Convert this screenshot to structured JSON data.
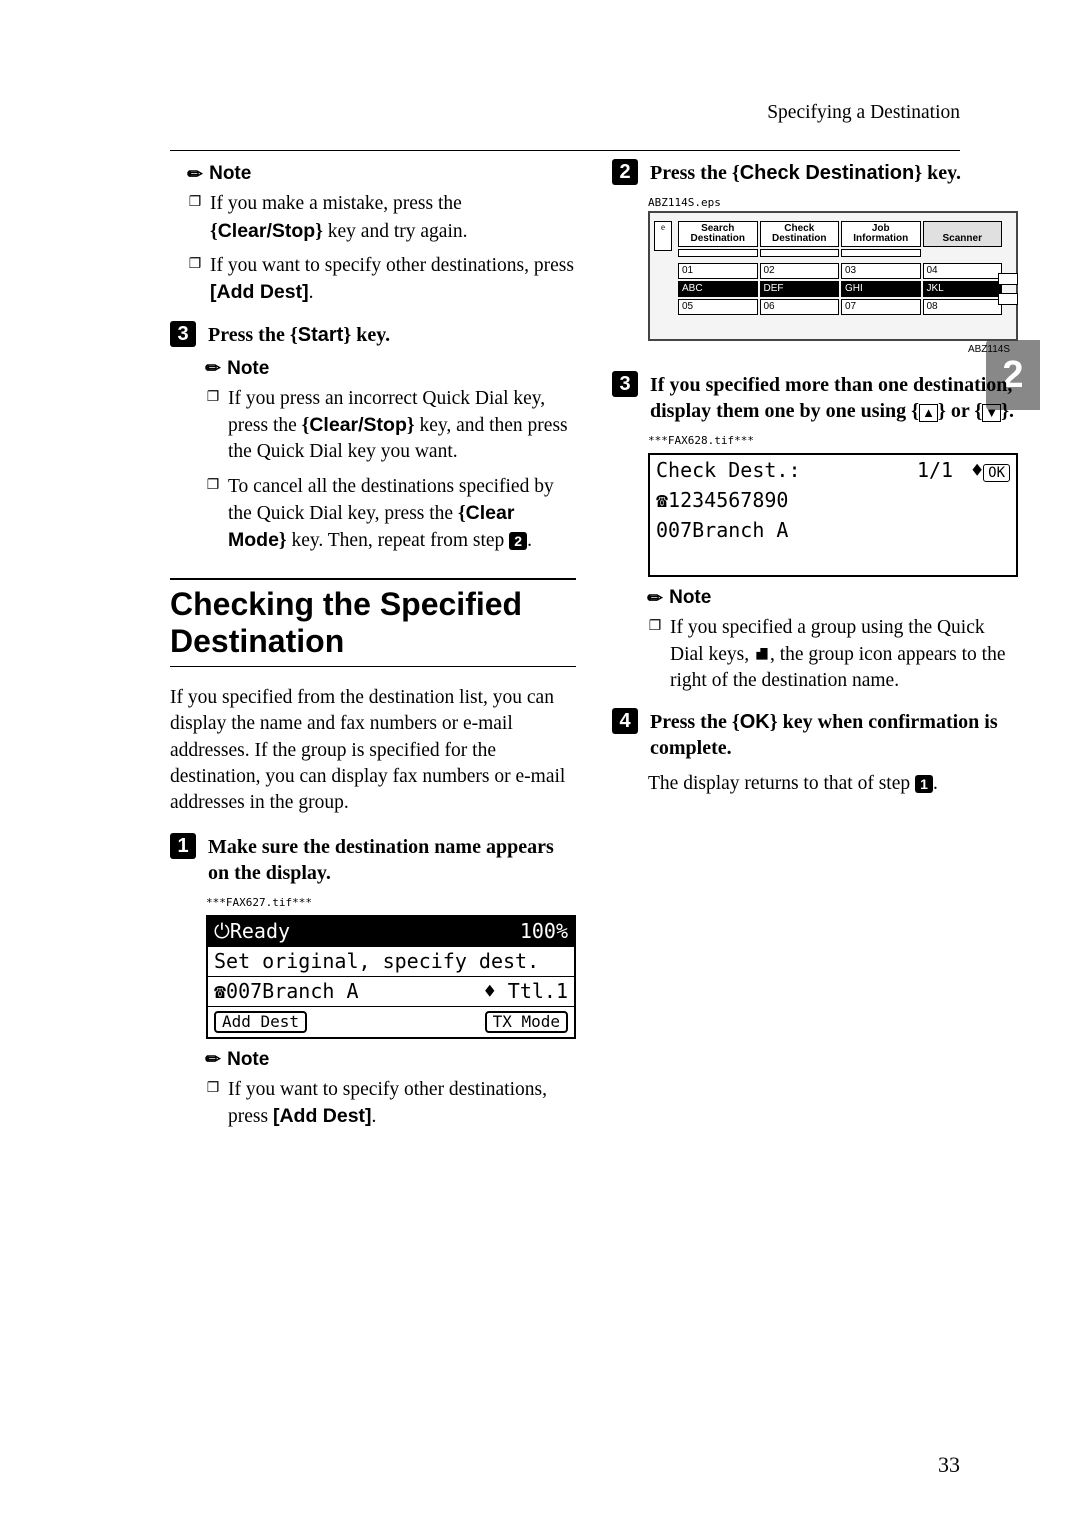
{
  "header": {
    "section": "Specifying a Destination"
  },
  "sideTab": "2",
  "pageNum": "33",
  "left": {
    "noteLabel": "Note",
    "note1a": "If you make a mistake, press the ",
    "note1b_key": "Clear/Stop",
    "note1c": " key and try again.",
    "note2a": "If you want to specify other destinations, press ",
    "note2b_key": "[Add Dest]",
    "note2c": ".",
    "step3_num": "3",
    "step3a": "Press the ",
    "step3_key": "Start",
    "step3b": " key.",
    "sub_noteLabel": "Note",
    "sub1a": "If you press an incorrect Quick Dial key, press the ",
    "sub1_key": "Clear/Stop",
    "sub1b": " key, and then press the Quick Dial key you want.",
    "sub2a": "To cancel all the destinations specified by the Quick Dial key, press the ",
    "sub2_key": "Clear Mode",
    "sub2b": " key. Then, repeat from step ",
    "sub2_step": "2",
    "sub2c": ".",
    "sectionTitle": "Checking the Specified Destination",
    "para": "If you specified from the destination list, you can display the name and fax numbers or e-mail addresses. If the group is specified for the destination, you can display fax numbers or e-mail addresses in the group.",
    "step1_num": "1",
    "step1": "Make sure the destination name appears on the display.",
    "cap1": "***FAX627.tif***",
    "lcd1_r1a": "Ready",
    "lcd1_r1b": "100%",
    "lcd1_r2": "Set original, specify dest.",
    "lcd1_r3a": "☎007Branch A",
    "lcd1_r3b": "Ttl.1",
    "lcd1_r4a": "Add Dest",
    "lcd1_r4b": "TX Mode",
    "bottom_noteLabel": "Note",
    "bottom1a": "If you want to specify other destinations, press ",
    "bottom1_key": "[Add Dest]",
    "bottom1b": "."
  },
  "right": {
    "step2_num": "2",
    "step2a": "Press the ",
    "step2_key": "Check Destination",
    "step2b": " key.",
    "cap2": "ABZ114S.eps",
    "panel": {
      "t1a": "Search",
      "t1b": "Destination",
      "t2a": "Check",
      "t2b": "Destination",
      "t3a": "Job",
      "t3b": "Information",
      "t4": "Scanner",
      "k01": "01",
      "k02": "02",
      "k03": "03",
      "k04": "04",
      "kABC": "ABC",
      "kDEF": "DEF",
      "kGHI": "GHI",
      "kJKL": "JKL",
      "k05": "05",
      "k06": "06",
      "k07": "07",
      "k08": "08",
      "label": "ABZ114S"
    },
    "step3_num": "3",
    "step3a": "If you specified more than one destination, display them one by one using ",
    "step3b": " or ",
    "step3c": ".",
    "cap3": "***FAX628.tif***",
    "lcd2_r1a": "Check Dest.:",
    "lcd2_r1b": "1/1",
    "lcd2_r1c": "OK",
    "lcd2_r2": "☎1234567890",
    "lcd2_r3": "007Branch A",
    "noteLabel": "Note",
    "n1a": "If you specified a group using the Quick Dial keys, ",
    "n1b": ", the group icon appears to the right of the destination name.",
    "step4_num": "4",
    "step4a": "Press the ",
    "step4_key": "OK",
    "step4b": " key when confirmation is complete.",
    "final": "The display returns to that of step ",
    "final_step": "1",
    "finalc": "."
  }
}
